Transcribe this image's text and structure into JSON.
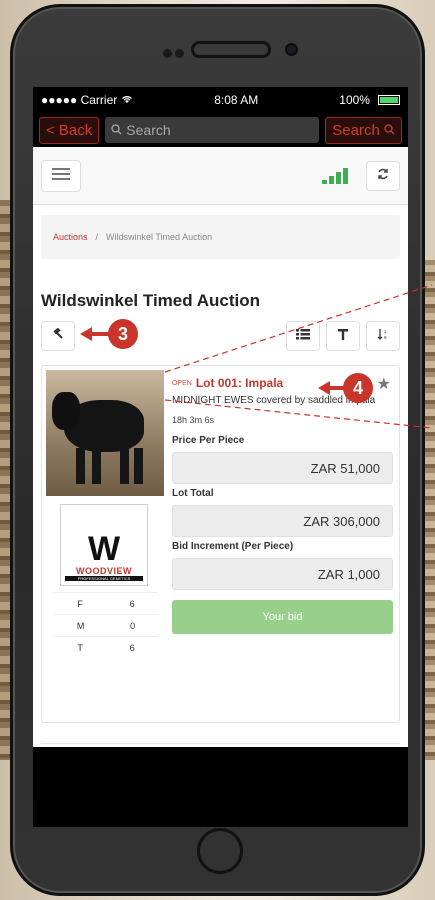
{
  "status_bar": {
    "carrier": "●●●●● Carrier",
    "time": "8:08 AM",
    "battery": "100%"
  },
  "nav_bar": {
    "back_label": "< Back",
    "search_placeholder": "Search",
    "search_button_label": "Search"
  },
  "breadcrumb": {
    "root": "Auctions",
    "separator": "/",
    "current": "Wildswinkel Timed Auction"
  },
  "page": {
    "title": "Wildswinkel Timed Auction"
  },
  "lot": {
    "status": "OPEN",
    "title": "Lot 001: Impala",
    "description": "MIDNIGHT EWES covered by saddled impala",
    "time_remaining": "18h 3m 6s",
    "price_per_piece_label": "Price Per Piece",
    "price_per_piece": "ZAR 51,000",
    "lot_total_label": "Lot Total",
    "lot_total": "ZAR 306,000",
    "bid_increment_label": "Bid Increment (Per Piece)",
    "bid_increment": "ZAR 1,000",
    "bid_button_label": "Your bid",
    "logo": {
      "brand": "WOODVIEW",
      "tagline": "PROFESSIONAL GENETICS"
    },
    "counts": [
      {
        "label": "F",
        "value": "6"
      },
      {
        "label": "M",
        "value": "0"
      },
      {
        "label": "T",
        "value": "6"
      }
    ]
  },
  "callouts": {
    "three": "3",
    "four": "4"
  },
  "colors": {
    "accent": "#c0392b",
    "bid_button": "#98cf8a",
    "signal": "#3cae52"
  },
  "icons": {
    "menu": "hamburger-icon",
    "signal": "signal-bars-icon",
    "refresh": "refresh-icon",
    "gavel": "gavel-icon",
    "list": "list-icon",
    "filter": "filter-icon",
    "sort": "sort-icon",
    "star": "star-icon"
  }
}
